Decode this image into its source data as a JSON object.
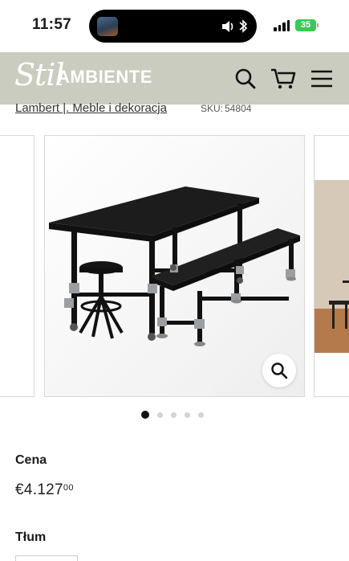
{
  "status_bar": {
    "time": "11:57",
    "battery": "35"
  },
  "header": {
    "logo_script": "Stil",
    "logo_text": "AMBIENTE",
    "icons": [
      "search-icon",
      "cart-icon",
      "menu-icon"
    ],
    "background_color": "#cbccc0"
  },
  "breadcrumb": {
    "brand": "Lambert |. Meble i dekoracja",
    "sku_label": "SKU:",
    "sku_value": "54804"
  },
  "gallery": {
    "slide_count": 5,
    "active_index": 0
  },
  "product": {
    "price_label": "Cena",
    "price_main": "€4.127",
    "price_cents": "00",
    "quantity_label": "Tłum"
  }
}
